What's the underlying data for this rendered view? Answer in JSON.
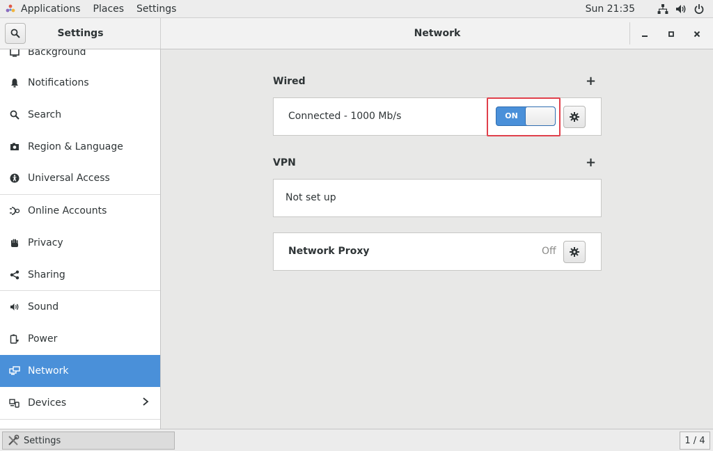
{
  "topbar": {
    "menus": [
      "Applications",
      "Places",
      "Settings"
    ],
    "clock": "Sun 21:35",
    "icons": [
      "network-wired-icon",
      "volume-icon",
      "power-icon"
    ]
  },
  "header": {
    "left_title": "Settings",
    "main_title": "Network",
    "controls": [
      "minimize",
      "maximize",
      "close"
    ]
  },
  "sidebar": {
    "items": [
      {
        "label": "Background",
        "icon": "background-icon"
      },
      {
        "label": "Notifications",
        "icon": "bell-icon"
      },
      {
        "label": "Search",
        "icon": "search-icon"
      },
      {
        "label": "Region & Language",
        "icon": "camera-flag-icon"
      },
      {
        "label": "Universal Access",
        "icon": "accessibility-icon"
      },
      {
        "label": "Online Accounts",
        "icon": "online-accounts-icon"
      },
      {
        "label": "Privacy",
        "icon": "hand-icon"
      },
      {
        "label": "Sharing",
        "icon": "share-icon"
      },
      {
        "label": "Sound",
        "icon": "speaker-icon"
      },
      {
        "label": "Power",
        "icon": "battery-plug-icon"
      },
      {
        "label": "Network",
        "icon": "network-icon",
        "active": true
      },
      {
        "label": "Devices",
        "icon": "devices-icon",
        "has_submenu": true
      }
    ],
    "active_color": "#4a90d9"
  },
  "wired": {
    "title": "Wired",
    "add": "+",
    "status": "Connected - 1000 Mb/s",
    "switch_label": "ON",
    "switch_on": true
  },
  "vpn": {
    "title": "VPN",
    "add": "+",
    "status": "Not set up"
  },
  "proxy": {
    "label": "Network Proxy",
    "value": "Off"
  },
  "bottombar": {
    "task_label": "Settings",
    "pager": "1 / 4"
  },
  "colors": {
    "accent": "#4a90d9",
    "highlight_box": "#e0404b"
  }
}
